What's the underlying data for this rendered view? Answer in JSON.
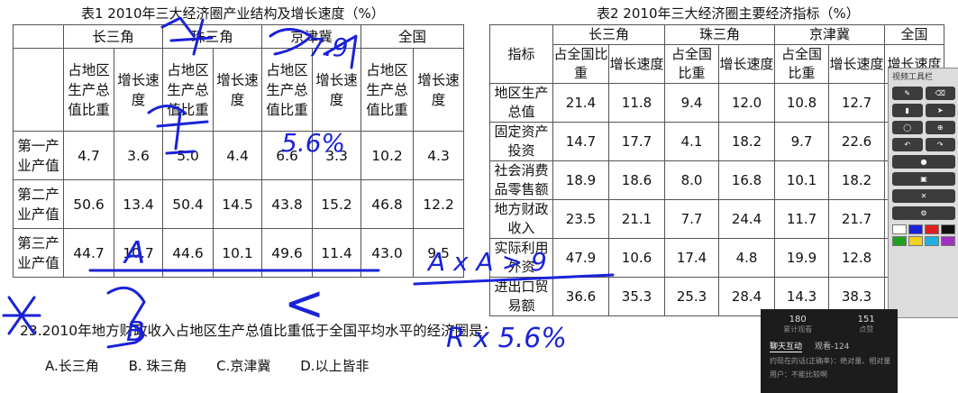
{
  "table1": {
    "caption": "表1 2010年三大经济圈产业结构及增长速度（%）",
    "regions": [
      "长三角",
      "珠三角",
      "京津冀",
      "全国"
    ],
    "subheaders": [
      "占地区生产总值比重",
      "增长速度",
      "占地区生产总值比重",
      "增长速度",
      "占地区生产总值比重",
      "增长速度",
      "占地区生产总值比重",
      "增长速度"
    ],
    "rows": [
      {
        "label": "第一产业产值",
        "values": [
          "4.7",
          "3.6",
          "5.0",
          "4.4",
          "6.6",
          "3.3",
          "10.2",
          "4.3"
        ]
      },
      {
        "label": "第二产业产值",
        "values": [
          "50.6",
          "13.4",
          "50.4",
          "14.5",
          "43.8",
          "15.2",
          "46.8",
          "12.2"
        ]
      },
      {
        "label": "第三产业产值",
        "values": [
          "44.7",
          "10.7",
          "44.6",
          "10.1",
          "49.6",
          "11.4",
          "43.0",
          "9.5"
        ]
      }
    ]
  },
  "table2": {
    "caption": "表2  2010年三大经济圈主要经济指标（%）",
    "regions": [
      "长三角",
      "珠三角",
      "京津冀",
      "全国"
    ],
    "indicator_header": "指标",
    "subheaders": [
      "占全国比重",
      "增长速度",
      "占全国比重",
      "增长速度",
      "占全国比重",
      "增长速度",
      "增长速度"
    ],
    "rows": [
      {
        "label": "地区生产总值",
        "values": [
          "21.4",
          "11.8",
          "9.4",
          "12.0",
          "10.8",
          "12.7",
          ""
        ]
      },
      {
        "label": "固定资产投资",
        "values": [
          "14.7",
          "17.7",
          "4.1",
          "18.2",
          "9.7",
          "22.6",
          ""
        ]
      },
      {
        "label": "社会消费品零售额",
        "values": [
          "18.9",
          "18.6",
          "8.0",
          "16.8",
          "10.1",
          "18.2",
          ""
        ]
      },
      {
        "label": "地方财政收入",
        "values": [
          "23.5",
          "21.1",
          "7.7",
          "24.4",
          "11.7",
          "21.7",
          ""
        ]
      },
      {
        "label": "实际利用外资",
        "values": [
          "47.9",
          "10.6",
          "17.4",
          "4.8",
          "19.9",
          "12.8",
          ""
        ]
      },
      {
        "label": "进出口贸易额",
        "values": [
          "36.6",
          "35.3",
          "25.3",
          "28.4",
          "14.3",
          "38.3",
          ""
        ]
      }
    ]
  },
  "question": {
    "text": "23.2010年地方财政收入占地区生产总值比重低于全国平均水平的经济圈是：",
    "options": [
      "A.长三角",
      "B. 珠三角",
      "C.京津冀",
      "D.以上皆非"
    ]
  },
  "annotations": {
    "ann1": "A",
    "ann2": "B",
    "ann3": "A x A > 9",
    "ann4": "R x 5.6%",
    "ann5": "5.6%",
    "ann6": "7.9",
    "ann7": "<"
  },
  "toolbar": {
    "title": "视频工具栏"
  },
  "chat_panel": {
    "stats": [
      {
        "num": "180",
        "label": "累计观看"
      },
      {
        "num": "151",
        "label": "点赞"
      }
    ],
    "tabs": [
      "聊天互动",
      "观看-124"
    ],
    "lines": [
      "约现在的话(正确率)：绝对量、相对量",
      "用户：不能比较啊"
    ]
  },
  "colors": {
    "ink": "#1a22d8",
    "toolbar_bg": "#dcdcdc",
    "chat_bg": "#1c1c1c"
  }
}
